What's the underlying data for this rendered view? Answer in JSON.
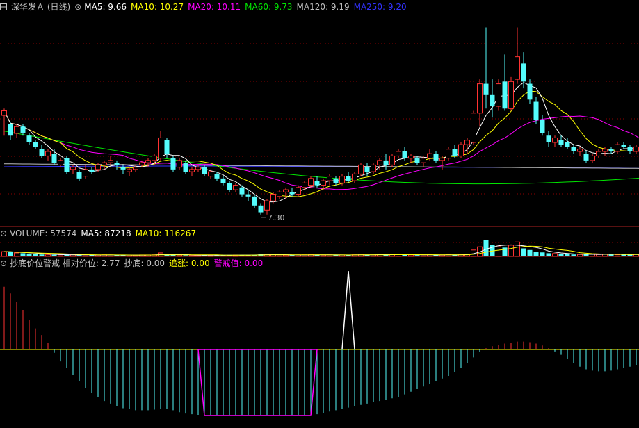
{
  "colors": {
    "background": "#000000",
    "up": "#ff3232",
    "down": "#54fcfc",
    "grid": "#8b0000",
    "separator": "#b22222",
    "ma5": "#ffffff",
    "ma10": "#ffff00",
    "ma20": "#ff00ff",
    "ma60": "#00e600",
    "ma120": "#c0c0c0",
    "ma250": "#3232ff"
  },
  "price_panel": {
    "title": "深华发Ａ (日线)",
    "ma_labels": [
      {
        "key": "ma5",
        "text": "MA5: 9.66"
      },
      {
        "key": "ma10",
        "text": "MA10: 10.27"
      },
      {
        "key": "ma20",
        "text": "MA20: 10.11"
      },
      {
        "key": "ma60",
        "text": "MA60: 9.73"
      },
      {
        "key": "ma120",
        "text": "MA120: 9.19"
      },
      {
        "key": "ma250",
        "text": "MA250: 9.20"
      }
    ],
    "min_marker": "7.30"
  },
  "volume_panel": {
    "labels": [
      {
        "key": "ma120",
        "text": "VOLUME: 57574"
      },
      {
        "key": "ma5",
        "text": "MA5: 87218"
      },
      {
        "key": "ma10",
        "text": "MA10: 116267"
      }
    ]
  },
  "indicator_panel": {
    "labels": [
      {
        "key": "ma120",
        "text": "抄底价位警戒 相对价位: 2.77"
      },
      {
        "key": "ma120",
        "text": "抄底: 0.00"
      },
      {
        "key": "ma10",
        "text": "追涨: 0.00"
      },
      {
        "key": "ma20",
        "text": "警戒值: 0.00"
      }
    ]
  },
  "chart_data": {
    "type": "candlestick",
    "candles": [
      [
        11.7,
        12.0,
        10.8,
        11.9
      ],
      [
        11.3,
        11.4,
        10.6,
        10.8
      ],
      [
        10.9,
        11.3,
        10.7,
        11.2
      ],
      [
        11.2,
        11.3,
        10.8,
        10.9
      ],
      [
        10.8,
        10.9,
        10.4,
        10.5
      ],
      [
        10.5,
        10.6,
        10.2,
        10.3
      ],
      [
        10.2,
        10.4,
        9.8,
        9.9
      ],
      [
        9.9,
        10.2,
        9.7,
        10.1
      ],
      [
        10.0,
        10.2,
        9.5,
        9.6
      ],
      [
        9.5,
        9.8,
        9.4,
        9.7
      ],
      [
        9.8,
        9.9,
        9.1,
        9.2
      ],
      [
        9.3,
        9.5,
        9.1,
        9.4
      ],
      [
        9.2,
        9.3,
        8.8,
        8.9
      ],
      [
        9.0,
        9.5,
        8.9,
        9.3
      ],
      [
        9.3,
        9.4,
        9.1,
        9.2
      ],
      [
        9.3,
        9.6,
        9.2,
        9.5
      ],
      [
        9.5,
        9.7,
        9.3,
        9.6
      ],
      [
        9.6,
        9.9,
        9.5,
        9.7
      ],
      [
        9.6,
        9.7,
        9.3,
        9.5
      ],
      [
        9.4,
        9.5,
        9.1,
        9.3
      ],
      [
        9.2,
        9.4,
        9.0,
        9.3
      ],
      [
        9.3,
        9.5,
        9.2,
        9.4
      ],
      [
        9.5,
        9.7,
        9.4,
        9.6
      ],
      [
        9.6,
        9.8,
        9.4,
        9.7
      ],
      [
        9.7,
        10.0,
        9.5,
        9.9
      ],
      [
        9.8,
        11.0,
        9.7,
        10.7
      ],
      [
        10.6,
        10.7,
        9.8,
        10.0
      ],
      [
        9.8,
        9.9,
        9.2,
        9.3
      ],
      [
        9.4,
        9.8,
        9.3,
        9.7
      ],
      [
        9.6,
        9.7,
        9.1,
        9.2
      ],
      [
        9.2,
        9.4,
        9.0,
        9.3
      ],
      [
        9.3,
        9.5,
        9.2,
        9.4
      ],
      [
        9.4,
        9.5,
        9.0,
        9.1
      ],
      [
        9.0,
        9.3,
        8.9,
        9.2
      ],
      [
        9.1,
        9.2,
        8.8,
        8.9
      ],
      [
        8.9,
        9.0,
        8.6,
        8.7
      ],
      [
        8.7,
        8.8,
        8.3,
        8.4
      ],
      [
        8.4,
        8.7,
        8.3,
        8.6
      ],
      [
        8.5,
        8.6,
        8.1,
        8.2
      ],
      [
        8.2,
        8.4,
        7.9,
        8.1
      ],
      [
        8.1,
        8.2,
        7.6,
        7.7
      ],
      [
        7.7,
        7.8,
        7.3,
        7.4
      ],
      [
        7.5,
        8.0,
        7.3,
        7.9
      ],
      [
        7.9,
        8.3,
        7.8,
        8.2
      ],
      [
        8.1,
        8.4,
        8.0,
        8.3
      ],
      [
        8.3,
        8.5,
        8.0,
        8.4
      ],
      [
        8.3,
        8.5,
        8.1,
        8.2
      ],
      [
        8.2,
        8.6,
        8.1,
        8.5
      ],
      [
        8.5,
        8.8,
        8.4,
        8.7
      ],
      [
        8.6,
        9.0,
        8.5,
        8.9
      ],
      [
        8.8,
        9.0,
        8.5,
        8.6
      ],
      [
        8.6,
        8.9,
        8.4,
        8.8
      ],
      [
        8.8,
        9.1,
        8.6,
        9.0
      ],
      [
        8.9,
        9.0,
        8.6,
        8.7
      ],
      [
        8.7,
        9.1,
        8.6,
        9.0
      ],
      [
        9.0,
        9.2,
        8.7,
        8.8
      ],
      [
        8.8,
        9.2,
        8.7,
        9.1
      ],
      [
        9.1,
        9.6,
        9.0,
        9.5
      ],
      [
        9.4,
        9.6,
        9.0,
        9.2
      ],
      [
        9.2,
        9.6,
        9.1,
        9.5
      ],
      [
        9.5,
        9.8,
        9.3,
        9.7
      ],
      [
        9.7,
        10.0,
        9.3,
        9.5
      ],
      [
        9.5,
        10.0,
        9.4,
        9.9
      ],
      [
        9.9,
        10.2,
        9.8,
        10.1
      ],
      [
        10.1,
        10.3,
        9.7,
        9.8
      ],
      [
        9.8,
        10.0,
        9.6,
        9.9
      ],
      [
        9.8,
        9.9,
        9.5,
        9.6
      ],
      [
        9.6,
        9.9,
        9.4,
        9.8
      ],
      [
        9.8,
        10.2,
        9.7,
        10.0
      ],
      [
        10.0,
        10.1,
        9.6,
        9.7
      ],
      [
        9.7,
        9.9,
        9.3,
        9.8
      ],
      [
        9.8,
        10.3,
        9.7,
        10.2
      ],
      [
        10.2,
        10.4,
        9.8,
        9.9
      ],
      [
        9.9,
        10.5,
        9.8,
        10.4
      ],
      [
        10.4,
        10.7,
        10.0,
        10.6
      ],
      [
        10.5,
        11.9,
        10.4,
        11.8
      ],
      [
        11.8,
        13.3,
        11.2,
        13.1
      ],
      [
        13.1,
        15.6,
        12.0,
        12.6
      ],
      [
        12.6,
        13.3,
        11.6,
        12.1
      ],
      [
        12.1,
        13.3,
        11.9,
        13.1
      ],
      [
        13.2,
        14.4,
        11.9,
        12.0
      ],
      [
        12.0,
        13.4,
        11.9,
        13.2
      ],
      [
        13.3,
        15.6,
        13.1,
        14.3
      ],
      [
        14.0,
        14.5,
        12.9,
        13.2
      ],
      [
        13.1,
        13.3,
        12.2,
        12.4
      ],
      [
        12.3,
        12.5,
        11.3,
        11.5
      ],
      [
        11.5,
        11.7,
        10.8,
        10.9
      ],
      [
        10.8,
        11.0,
        10.3,
        10.5
      ],
      [
        10.5,
        10.8,
        10.3,
        10.7
      ],
      [
        10.6,
        10.8,
        10.3,
        10.4
      ],
      [
        10.5,
        10.7,
        10.2,
        10.3
      ],
      [
        10.3,
        10.4,
        10.0,
        10.1
      ],
      [
        10.1,
        10.3,
        9.9,
        10.2
      ],
      [
        10.0,
        10.1,
        9.6,
        9.7
      ],
      [
        9.7,
        10.0,
        9.6,
        9.9
      ],
      [
        9.9,
        10.2,
        9.8,
        10.1
      ],
      [
        10.1,
        10.3,
        9.9,
        10.2
      ],
      [
        10.2,
        10.3,
        10.0,
        10.1
      ],
      [
        10.1,
        10.5,
        10.0,
        10.4
      ],
      [
        10.4,
        10.5,
        10.2,
        10.3
      ],
      [
        10.3,
        10.4,
        10.0,
        10.1
      ],
      [
        10.1,
        10.4,
        10.0,
        10.3
      ],
      [
        10.3,
        10.6,
        10.2,
        10.5
      ],
      [
        10.5,
        10.8,
        10.4,
        10.7
      ],
      [
        10.7,
        10.8,
        10.3,
        10.4
      ],
      [
        10.4,
        10.5,
        9.8,
        9.9
      ],
      [
        9.9,
        10.3,
        9.8,
        10.2
      ],
      [
        10.2,
        10.6,
        10.1,
        10.5
      ],
      [
        10.5,
        10.8,
        10.4,
        10.7
      ],
      [
        10.7,
        11.1,
        10.6,
        10.9
      ],
      [
        10.9,
        11.4,
        10.8,
        11.2
      ],
      [
        11.2,
        11.6,
        11.0,
        11.5
      ]
    ],
    "ma_periods": {
      "ma5": 5,
      "ma10": 10,
      "ma20": 20,
      "ma60": 60,
      "ma120": 120,
      "ma250": 250
    },
    "ma60_start": [
      11.0,
      9.55
    ],
    "long_ma_levels": {
      "ma120": 9.55,
      "ma250": 9.42
    },
    "volume": [
      30,
      28,
      22,
      20,
      18,
      15,
      12,
      10,
      10,
      9,
      12,
      10,
      8,
      9,
      9,
      8,
      10,
      9,
      8,
      7,
      8,
      8,
      9,
      9,
      10,
      22,
      12,
      9,
      8,
      7,
      7,
      7,
      8,
      7,
      8,
      8,
      9,
      8,
      9,
      8,
      10,
      14,
      12,
      11,
      9,
      8,
      8,
      9,
      10,
      11,
      9,
      8,
      10,
      9,
      9,
      8,
      10,
      14,
      10,
      9,
      12,
      11,
      12,
      14,
      10,
      9,
      8,
      9,
      11,
      9,
      8,
      12,
      10,
      12,
      14,
      40,
      60,
      100,
      70,
      65,
      55,
      70,
      90,
      50,
      40,
      30,
      25,
      20,
      18,
      15,
      14,
      12,
      12,
      14,
      14,
      12,
      14,
      12,
      10,
      11,
      12,
      13,
      11,
      12,
      10,
      12,
      13,
      14,
      16,
      18
    ],
    "oscillator": [
      95,
      85,
      72,
      60,
      45,
      32,
      22,
      10,
      -5,
      -18,
      -28,
      -38,
      -48,
      -58,
      -66,
      -72,
      -78,
      -82,
      -86,
      -89,
      -90,
      -92,
      -92,
      -92,
      -91,
      -90,
      -90,
      -92,
      -95,
      -97,
      -98,
      -99,
      -100,
      -100,
      -100,
      -100,
      -100,
      -100,
      -100,
      -100,
      -100,
      -100,
      -100,
      -100,
      -100,
      -100,
      -100,
      -100,
      -100,
      -100,
      -98,
      -96,
      -94,
      -92,
      -90,
      -88,
      -86,
      -84,
      -82,
      -80,
      -78,
      -76,
      -74,
      -72,
      -68,
      -64,
      -60,
      -56,
      -52,
      -48,
      -44,
      -40,
      -34,
      -28,
      -20,
      -12,
      -4,
      2,
      5,
      7,
      9,
      10,
      12,
      12,
      11,
      9,
      6,
      2,
      -3,
      -8,
      -14,
      -20,
      -26,
      -30,
      -32,
      -33,
      -33,
      -32,
      -30,
      -28,
      -26,
      -24,
      -22,
      -20,
      -18,
      -16,
      -14,
      -12,
      -10,
      -9
    ],
    "spike_index": 55
  }
}
